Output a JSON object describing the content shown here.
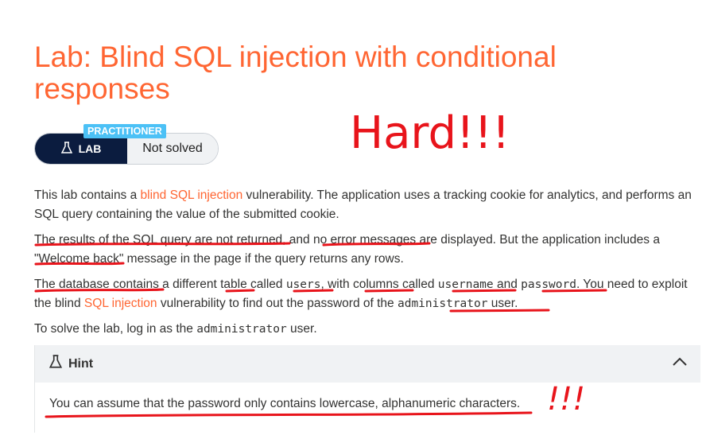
{
  "title": "Lab: Blind SQL injection with conditional responses",
  "badge": {
    "level": "PRACTITIONER",
    "lab": "LAB",
    "status": "Not solved"
  },
  "description": {
    "p1_pre": "This lab contains a ",
    "p1_link": "blind SQL injection",
    "p1_post": " vulnerability. The application uses a tracking cookie for analytics, and performs an SQL query containing the value of the submitted cookie.",
    "p2": "The results of the SQL query are not returned, and no error messages are displayed. But the application includes a \"Welcome back\" message in the page if the query returns any rows.",
    "p3_a": "The database contains a different table called ",
    "p3_code1": "users",
    "p3_b": ", with columns called ",
    "p3_code2": "username",
    "p3_c": " and ",
    "p3_code3": "password",
    "p3_d": ". You need to exploit the blind ",
    "p3_link": "SQL injection",
    "p3_e": " vulnerability to find out the password of the ",
    "p3_code4": "administrator",
    "p3_f": " user.",
    "p4_pre": "To solve the lab, log in as the ",
    "p4_code": "administrator",
    "p4_post": " user."
  },
  "hint": {
    "label": "Hint",
    "text": "You can assume that the password only contains lowercase, alphanumeric characters."
  },
  "annotations": {
    "hard": "Hard!!!",
    "exclaim": "!!!"
  },
  "colors": {
    "accent": "#ff6633",
    "navy": "#0b1c3f",
    "practitioner": "#4cc1f6",
    "annotation": "#e8141b"
  }
}
